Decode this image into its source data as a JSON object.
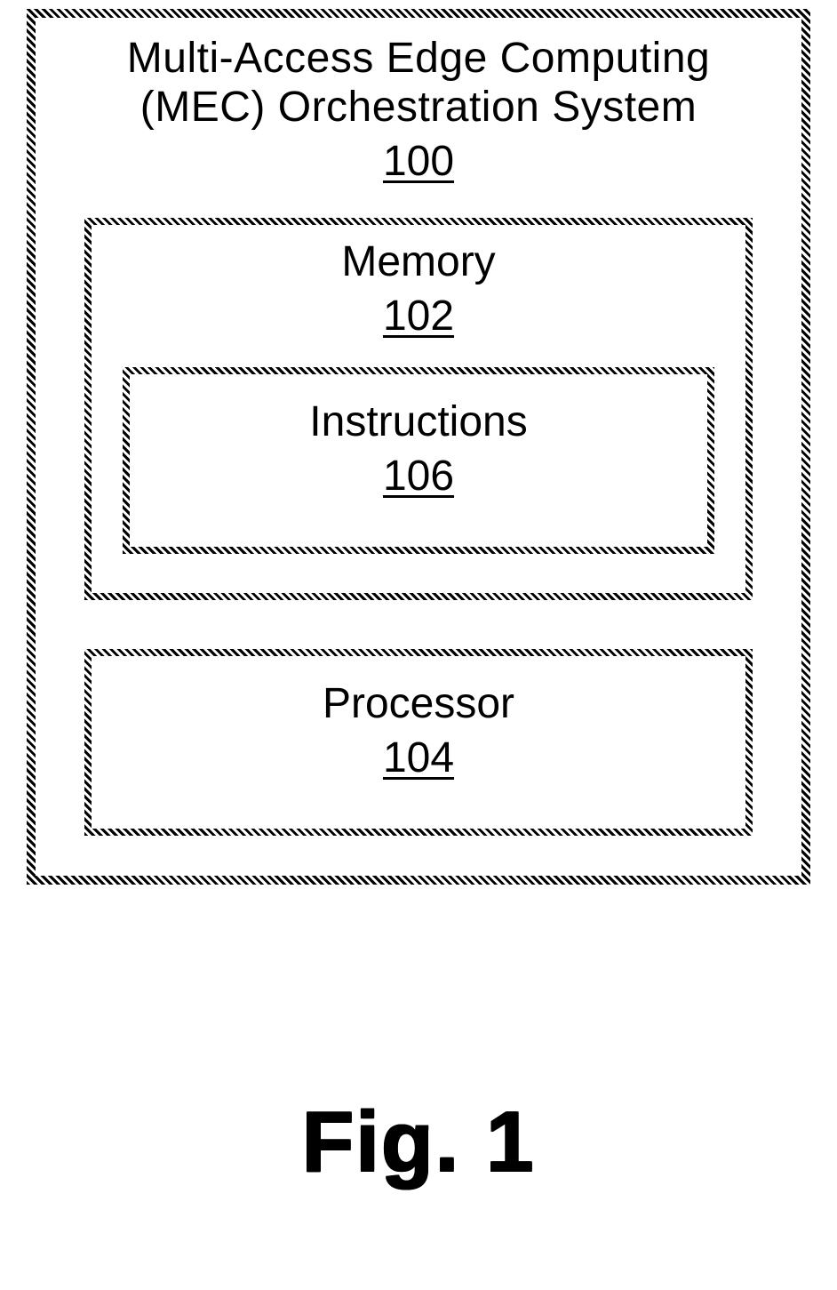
{
  "diagram": {
    "outer": {
      "title_line1": "Multi-Access Edge Computing",
      "title_line2": "(MEC) Orchestration System",
      "ref": "100"
    },
    "memory": {
      "label": "Memory",
      "ref": "102"
    },
    "instructions": {
      "label": "Instructions",
      "ref": "106"
    },
    "processor": {
      "label": "Processor",
      "ref": "104"
    }
  },
  "caption": "Fig. 1"
}
